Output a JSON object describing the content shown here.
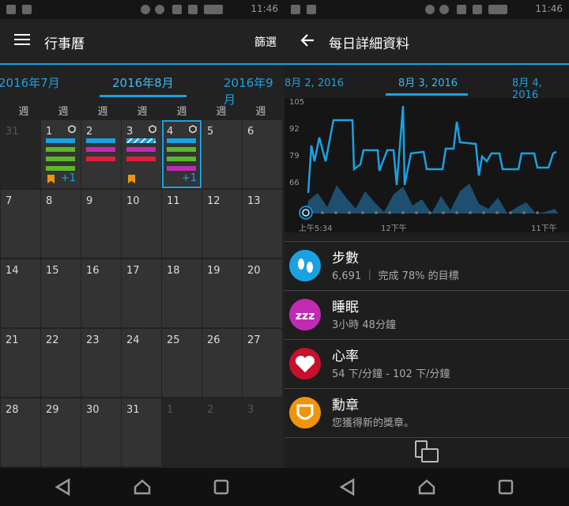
{
  "left": {
    "status_time": "11:46",
    "appbar": {
      "title": "行事曆",
      "filter_label": "篩選"
    },
    "months": [
      "2016年7月",
      "2016年8月",
      "2016年9月"
    ],
    "week_label": "週",
    "week_headers": [
      "週",
      "週",
      "週",
      "週",
      "週",
      "週",
      "週"
    ],
    "days": [
      {
        "n": "31",
        "out": true
      },
      {
        "n": "1"
      },
      {
        "n": "2"
      },
      {
        "n": "3"
      },
      {
        "n": "4",
        "today": true
      },
      {
        "n": "5"
      },
      {
        "n": "6"
      },
      {
        "n": "7"
      },
      {
        "n": "8"
      },
      {
        "n": "9"
      },
      {
        "n": "10"
      },
      {
        "n": "11"
      },
      {
        "n": "12"
      },
      {
        "n": "13"
      },
      {
        "n": "14"
      },
      {
        "n": "15"
      },
      {
        "n": "16"
      },
      {
        "n": "17"
      },
      {
        "n": "18"
      },
      {
        "n": "19"
      },
      {
        "n": "20"
      },
      {
        "n": "21"
      },
      {
        "n": "22"
      },
      {
        "n": "23"
      },
      {
        "n": "24"
      },
      {
        "n": "25"
      },
      {
        "n": "26"
      },
      {
        "n": "27"
      },
      {
        "n": "28"
      },
      {
        "n": "29"
      },
      {
        "n": "30"
      },
      {
        "n": "31"
      },
      {
        "n": "1",
        "out": true
      },
      {
        "n": "2",
        "out": true
      },
      {
        "n": "3",
        "out": true
      }
    ],
    "more_label": "+1"
  },
  "right": {
    "status_time": "11:46",
    "appbar": {
      "title": "每日詳細資料"
    },
    "dates": [
      "8月 2, 2016",
      "8月 3, 2016",
      "8月 4, 2016"
    ],
    "chart_data": {
      "type": "line",
      "y_ticks": [
        "105",
        "92",
        "79",
        "66"
      ],
      "x_labels": [
        "上午5:34",
        "12下午",
        "11下午"
      ]
    },
    "items": [
      {
        "title": "步數",
        "sub": "6,691 ｜ 完成 78% 的目標",
        "color": "#1ba1e2",
        "icon": "steps-icon"
      },
      {
        "title": "睡眠",
        "sub": "3小時 48分鐘",
        "color": "#c12bb4",
        "icon": "sleep-icon"
      },
      {
        "title": "心率",
        "sub": "54 下/分鐘 - 102 下/分鐘",
        "color": "#c8102e",
        "icon": "heart-icon"
      },
      {
        "title": "勳章",
        "sub": "您獲得新的獎章。",
        "color": "#f0940d",
        "icon": "badge-icon"
      }
    ]
  }
}
